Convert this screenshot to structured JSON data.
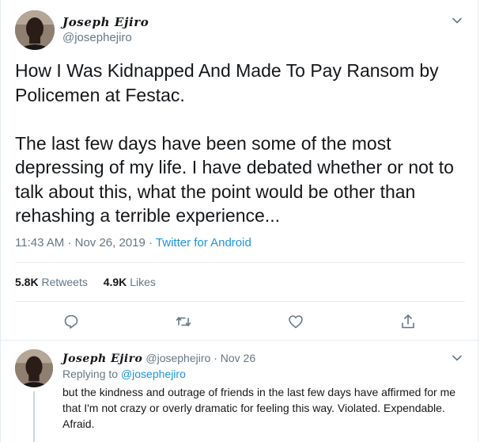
{
  "main_tweet": {
    "display_name": "Joseph Ejiro",
    "handle": "@josephejiro",
    "text": "How I Was Kidnapped And Made To Pay Ransom by Policemen at Festac.\n\nThe last few days have been some of the most depressing of my life. I have debated whether or not to talk about this, what the point would be other than rehashing a terrible experience...",
    "time": "11:43 AM",
    "date": "Nov 26, 2019",
    "separator": " · ",
    "source": "Twitter for Android",
    "retweets_count": "5.8K",
    "retweets_label": "Retweets",
    "likes_count": "4.9K",
    "likes_label": "Likes"
  },
  "reply_tweet": {
    "display_name": "Joseph Ejiro",
    "handle": "@josephejiro",
    "date_prefix": " · ",
    "date": "Nov 26",
    "replying_label": "Replying to ",
    "replying_to": "@josephejiro",
    "text": "but the kindness and outrage of friends in the last few days have affirmed for me that I'm not crazy or overly dramatic for feeling this way. Violated. Expendable. Afraid."
  },
  "icons": {
    "reply": "reply-icon",
    "retweet": "retweet-icon",
    "like": "heart-icon",
    "share": "share-icon",
    "more": "chevron-down-icon"
  },
  "colors": {
    "link": "#1b95e0",
    "secondary_text": "#657786",
    "primary_text": "#14171a",
    "border": "#e6ecf0"
  }
}
